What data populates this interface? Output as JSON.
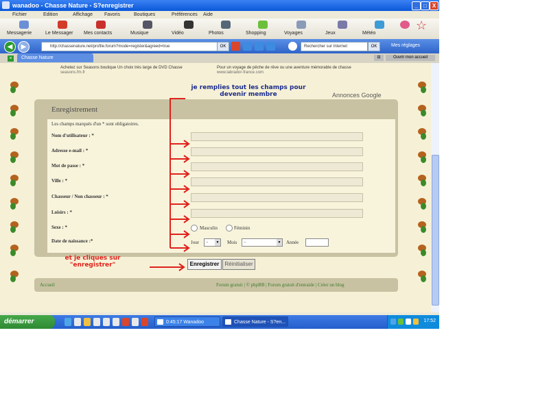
{
  "window": {
    "title": "wanadoo -   Chasse Nature - S?enregistrer",
    "buttons": [
      "_",
      "□",
      "X"
    ]
  },
  "menu": [
    "Fichier",
    "Edition",
    "Affichage",
    "Favoris",
    "Boutiques",
    "Préférences",
    "Aide"
  ],
  "toolbar": {
    "items": [
      "Messagerie",
      "Le Messager",
      "Mes contacts",
      "Musique",
      "Vidéo",
      "Photos",
      "Shopping",
      "Voyages",
      "Jeux",
      "Météo"
    ]
  },
  "address": {
    "url": "http://chassenature.net/profile.forum?mode=register&agreed=true",
    "go": "OK",
    "search_placeholder": "Rechercher sur Internet",
    "search_go": "OK",
    "settings": "Mes réglages"
  },
  "tabs": {
    "active": "Chasse Nature",
    "home_button": "Ouvrir mon accueil"
  },
  "ads": {
    "left_text": "Achetez sur Seasons boutique Un choix très large de DVD Chasse",
    "left_url": "seasons.fm.fr",
    "right_text": "Pour un voyage de pêche de rêve ou une aventure mémorable de chasse",
    "right_url": "www.labrador-france.com",
    "google": "Annonces Google"
  },
  "form": {
    "title": "Enregistrement",
    "required_note": "Les champs marqués d'un * sont obligatoires.",
    "fields": [
      "Nom d'utilisateur : *",
      "Adresse e-mail : *",
      "Mot de passe : *",
      "Ville : *",
      "Chasseur / Non chasseur : *",
      "Loisirs : *",
      "Sexe : *",
      "Date de naissance :*"
    ],
    "sex_options": [
      "Masculin",
      "Féminin"
    ],
    "birth": {
      "day_label": "Jour",
      "day_value": "-",
      "month_label": "Mois",
      "month_value": "-",
      "year_label": "Année"
    },
    "submit": "Enregistrer",
    "reset": "Réinitialiser"
  },
  "annotations": {
    "top_line1": "je remplies tout les champs pour",
    "top_line2": "devenir membre",
    "bottom_line1": "et je cliques sur",
    "bottom_line2": "\"enregistrer\"",
    "color": "#e0201a"
  },
  "footer": {
    "home": "Accueil",
    "links": "Forum gratuit  |  © phpBB  |  Forum gratuit d'entraide  |  Créer un blog"
  },
  "taskbar": {
    "start": "démarrer",
    "tasks": [
      "0:45:17 Wanadoo",
      "Chasse Nature - S?en..."
    ],
    "clock": "17:52"
  },
  "colors": {
    "page_bg": "#f6f1d6",
    "form_frame": "#c8c2a2",
    "link_green": "#3b7a2a"
  }
}
